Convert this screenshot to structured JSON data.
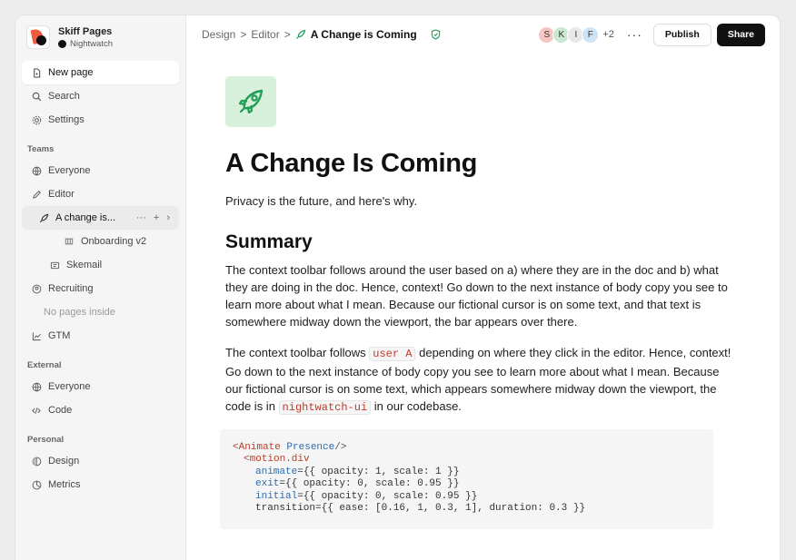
{
  "workspace": {
    "name": "Skiff Pages",
    "org": "Nightwatch"
  },
  "nav": {
    "new_page": "New page",
    "search": "Search",
    "settings": "Settings"
  },
  "teams": {
    "label": "Teams",
    "everyone": "Everyone",
    "editor": "Editor",
    "current_page": "A change is...",
    "onboarding": "Onboarding v2",
    "skemail": "Skemail",
    "recruiting": "Recruiting",
    "no_pages": "No pages inside",
    "gtm": "GTM"
  },
  "external": {
    "label": "External",
    "everyone": "Everyone",
    "code": "Code"
  },
  "personal": {
    "label": "Personal",
    "design": "Design",
    "metrics": "Metrics"
  },
  "breadcrumb": {
    "root": "Design",
    "parent": "Editor",
    "current": "A Change is Coming",
    "sep": ">"
  },
  "header": {
    "avatars": [
      {
        "initial": "S",
        "color": "#f6c6c2"
      },
      {
        "initial": "K",
        "color": "#cde8d0"
      },
      {
        "initial": "I",
        "color": "#e8e8e8"
      },
      {
        "initial": "F",
        "color": "#cfe3f7"
      }
    ],
    "more": "+2",
    "publish": "Publish",
    "share": "Share"
  },
  "document": {
    "title": "A Change Is Coming",
    "lead": "Privacy is the future, and here's why.",
    "summary_heading": "Summary",
    "p1": "The context toolbar follows around the user based on a) where they are in the doc and b) what they are doing in the doc. Hence, context! Go down to the next instance of body copy you see to learn more about what I mean. Because our fictional cursor is on some text, and that text is somewhere midway down the viewport, the bar appears over there.",
    "p2_a": "The context toolbar follows",
    "p2_code1": "user A",
    "p2_b": "depending on where they click in the editor. Hence, context! Go down to the next instance of body copy you see to learn more about what I mean. Because our fictional cursor is on some text, which appears somewhere midway down the viewport, the code is in",
    "p2_code2": "nightwatch-ui",
    "p2_c": "in our codebase."
  },
  "code": {
    "l1_tag": "<Animate",
    "l1_attr": "Presence",
    "l1_end": "/>",
    "l2": "<motion.div",
    "l3_attr": "animate",
    "l3_val": "={{ opacity: 1, scale: 1 }}",
    "l4_attr": "exit",
    "l4_val": "={{ opacity: 0, scale: 0.95 }}",
    "l5_attr": "initial",
    "l5_val": "={{ opacity: 0, scale: 0.95 }}",
    "l6": "transition={{ ease: [0.16, 1, 0.3, 1], duration: 0.3 }}"
  }
}
